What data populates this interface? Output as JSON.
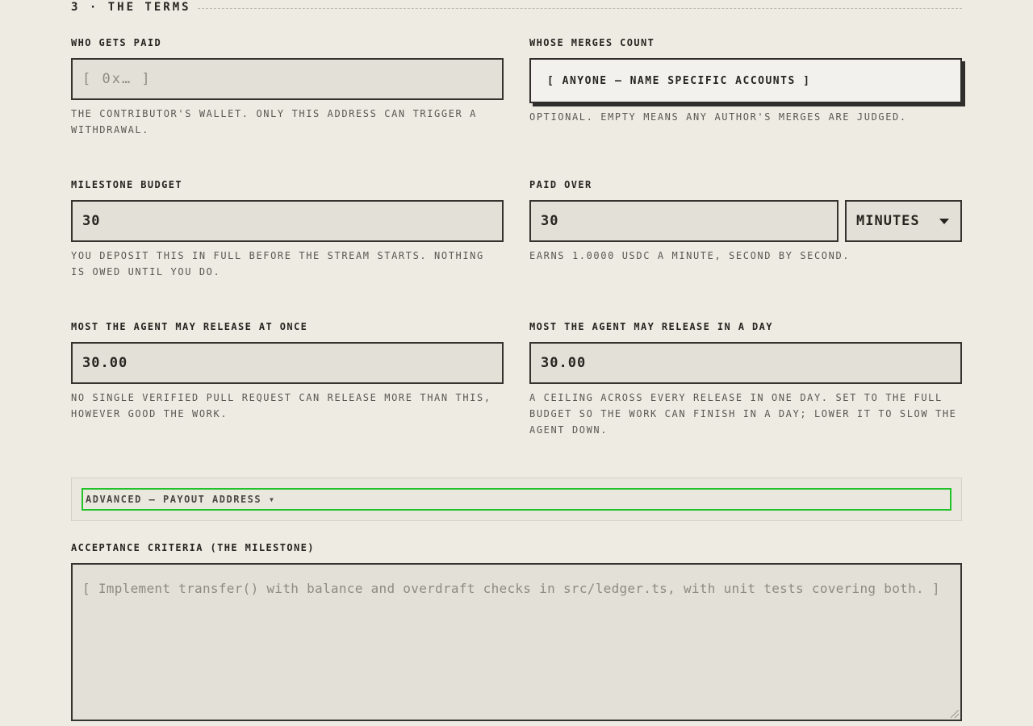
{
  "section": {
    "title": "3 · THE TERMS"
  },
  "who_gets_paid": {
    "label": "WHO GETS PAID",
    "placeholder": "[ 0x… ]",
    "help": "THE CONTRIBUTOR'S WALLET. ONLY THIS ADDRESS CAN TRIGGER A WITHDRAWAL."
  },
  "whose_merges_count": {
    "label": "WHOSE MERGES COUNT",
    "button_label": "[ ANYONE — NAME SPECIFIC ACCOUNTS ]",
    "help": "OPTIONAL. EMPTY MEANS ANY AUTHOR'S MERGES ARE JUDGED."
  },
  "milestone_budget": {
    "label": "MILESTONE BUDGET",
    "value": "30",
    "help": "YOU DEPOSIT THIS IN FULL BEFORE THE STREAM STARTS. NOTHING IS OWED UNTIL YOU DO."
  },
  "paid_over": {
    "label": "PAID OVER",
    "value": "30",
    "unit_selected": "MINUTES",
    "help": "EARNS 1.0000 USDC A MINUTE, SECOND BY SECOND."
  },
  "max_release_once": {
    "label": "MOST THE AGENT MAY RELEASE AT ONCE",
    "value": "30.00",
    "help": "NO SINGLE VERIFIED PULL REQUEST CAN RELEASE MORE THAN THIS, HOWEVER GOOD THE WORK."
  },
  "max_release_day": {
    "label": "MOST THE AGENT MAY RELEASE IN A DAY",
    "value": "30.00",
    "help": "A CEILING ACROSS EVERY RELEASE IN ONE DAY. SET TO THE FULL BUDGET SO THE WORK CAN FINISH IN A DAY; LOWER IT TO SLOW THE AGENT DOWN."
  },
  "advanced": {
    "summary": "ADVANCED — PAYOUT ADDRESS ▾"
  },
  "acceptance": {
    "label": "ACCEPTANCE CRITERIA (THE MILESTONE)",
    "placeholder": "[ Implement transfer() with balance and overdraft checks in src/ledger.ts, with unit tests covering both. ]"
  },
  "colors": {
    "background": "#eeebe3",
    "input_bg": "#e3e0d7",
    "border": "#34332e",
    "focus_ring": "#22c22a"
  }
}
